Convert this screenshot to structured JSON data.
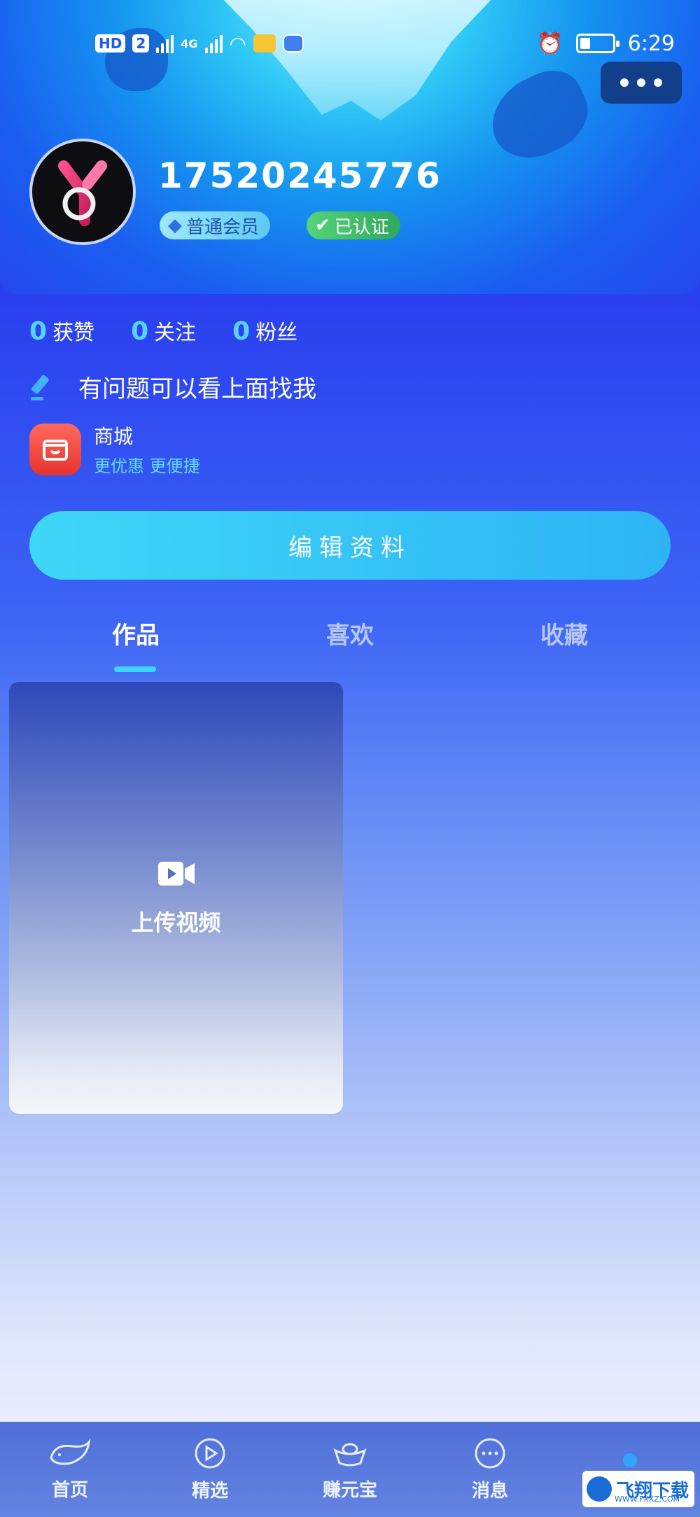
{
  "status_bar": {
    "hd_label": "HD",
    "sim_label": "2",
    "network_label": "4G",
    "time": "6:29"
  },
  "profile": {
    "username": "17520245776",
    "member_badge": "普通会员",
    "verified_badge": "已认证"
  },
  "stats": [
    {
      "value": "0",
      "label": "获赞"
    },
    {
      "value": "0",
      "label": "关注"
    },
    {
      "value": "0",
      "label": "粉丝"
    }
  ],
  "bio": "有问题可以看上面找我",
  "shop": {
    "title": "商城",
    "subtitle": "更优惠 更便捷"
  },
  "edit_button": "编辑资料",
  "tabs": [
    {
      "label": "作品",
      "active": true
    },
    {
      "label": "喜欢",
      "active": false
    },
    {
      "label": "收藏",
      "active": false
    }
  ],
  "upload": {
    "label": "上传视频",
    "icon": "video-camera-icon"
  },
  "tabbar": [
    {
      "label": "首页",
      "icon": "whale-icon"
    },
    {
      "label": "精选",
      "icon": "play-circle-icon"
    },
    {
      "label": "赚元宝",
      "icon": "ingot-icon"
    },
    {
      "label": "消息",
      "icon": "chat-dots-icon"
    },
    {
      "label": "",
      "icon": "user-icon"
    }
  ],
  "watermark": {
    "text": "飞翔下载",
    "subtext": "WWW.FXXZ.COM"
  },
  "colors": {
    "accent": "#3fd7f8",
    "stat_number": "#56d4ff",
    "shop_red": "#e8322f"
  }
}
